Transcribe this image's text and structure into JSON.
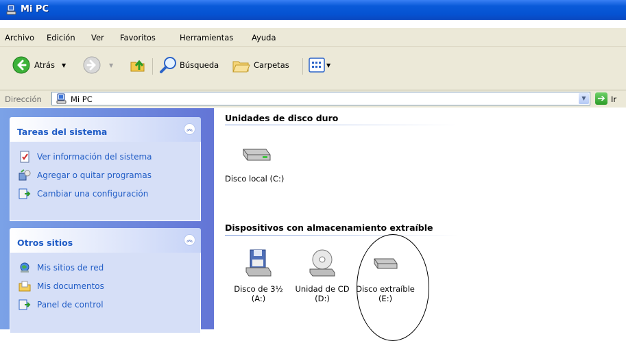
{
  "window": {
    "title": "Mi PC"
  },
  "menu": [
    "Archivo",
    "Edición",
    "Ver",
    "Favoritos",
    "Herramientas",
    "Ayuda"
  ],
  "toolbar": {
    "back_label": "Atrás",
    "search_label": "Búsqueda",
    "folders_label": "Carpetas"
  },
  "address": {
    "label": "Dirección",
    "value": "Mi PC",
    "go_label": "Ir"
  },
  "panels": {
    "system": {
      "title": "Tareas del sistema",
      "items": [
        "Ver información del sistema",
        "Agregar o quitar programas",
        "Cambiar una configuración"
      ]
    },
    "other": {
      "title": "Otros sitios",
      "items": [
        "Mis sitios de red",
        "Mis documentos",
        "Panel de control"
      ]
    }
  },
  "sections": {
    "hard_disks": {
      "title": "Unidades de disco duro",
      "drives": [
        {
          "label": "Disco local (C:)"
        }
      ]
    },
    "removable": {
      "title": "Dispositivos con almacenamiento extraíble",
      "drives": [
        {
          "line1": "Disco de 3½",
          "line2": "(A:)"
        },
        {
          "line1": "Unidad de CD",
          "line2": "(D:)"
        },
        {
          "line1": "Disco extraíble",
          "line2": "(E:)"
        }
      ]
    }
  },
  "colors": {
    "title_bar": "#0553d2",
    "task_pane": "#6f8fdf",
    "link": "#215dc6"
  }
}
